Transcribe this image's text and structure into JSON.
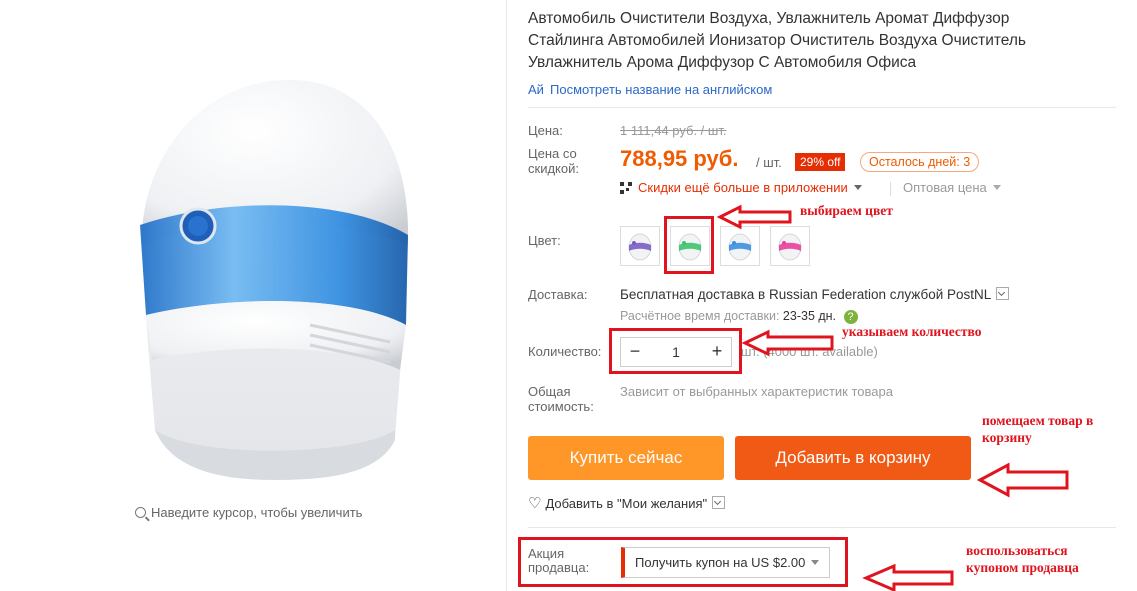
{
  "product": {
    "title": "Автомобиль Очистители Воздуха, Увлажнитель Аромат Диффузор Стайлинга Автомобилей Ионизатор Очиститель Воздуха Очиститель Увлажнитель Арома Диффузор С Автомобиля Офиса",
    "translate_link": "Посмотреть название на английском",
    "zoom_hint": "Наведите курсор, чтобы увеличить"
  },
  "price": {
    "label": "Цена:",
    "original": "1 111,44 руб. / шт.",
    "discount_label": "Цена со скидкой:",
    "current": "788,95 руб.",
    "per_unit": "/ шт.",
    "discount_badge": "29% off",
    "days_left": "Осталось дней: 3",
    "app_promo": "Скидки ещё больше в приложении",
    "wholesale": "Оптовая цена"
  },
  "color": {
    "label": "Цвет:",
    "options": [
      {
        "name": "purple",
        "accent": "#7b5cc4"
      },
      {
        "name": "green",
        "accent": "#3cc46c"
      },
      {
        "name": "blue",
        "accent": "#3b8fe0"
      },
      {
        "name": "pink",
        "accent": "#e8409a"
      }
    ],
    "selected": 1
  },
  "shipping": {
    "label": "Доставка:",
    "text": "Бесплатная доставка в Russian Federation службой PostNL",
    "eta_label": "Расчётное время доставки:",
    "eta_days": "23-35 дн."
  },
  "quantity": {
    "label": "Количество:",
    "value": "1",
    "minus": "−",
    "plus": "+",
    "stock": "шт. (4000 шт. available)"
  },
  "total": {
    "label_line1": "Общая",
    "label_line2": "стоимость:",
    "note": "Зависит от выбранных характеристик товара"
  },
  "actions": {
    "buy_now": "Купить сейчас",
    "add_to_cart": "Добавить в корзину",
    "wishlist": "Добавить в \"Мои желания\""
  },
  "promo": {
    "label_line1": "Акция",
    "label_line2": "продавца:",
    "coupon": "Получить купон на US $2.00"
  },
  "annotations": {
    "color": "выбираем цвет",
    "quantity": "указываем количество",
    "cart_line1": "помещаем товар в",
    "cart_line2": "корзину",
    "coupon_line1": "воспользоваться",
    "coupon_line2": "купоном продавца"
  },
  "colors": {
    "price_accent": "#f05a00",
    "buy_now": "#ff9628",
    "add_to_cart": "#f05a14",
    "annotation": "#e0141e",
    "link": "#2a68c9"
  }
}
